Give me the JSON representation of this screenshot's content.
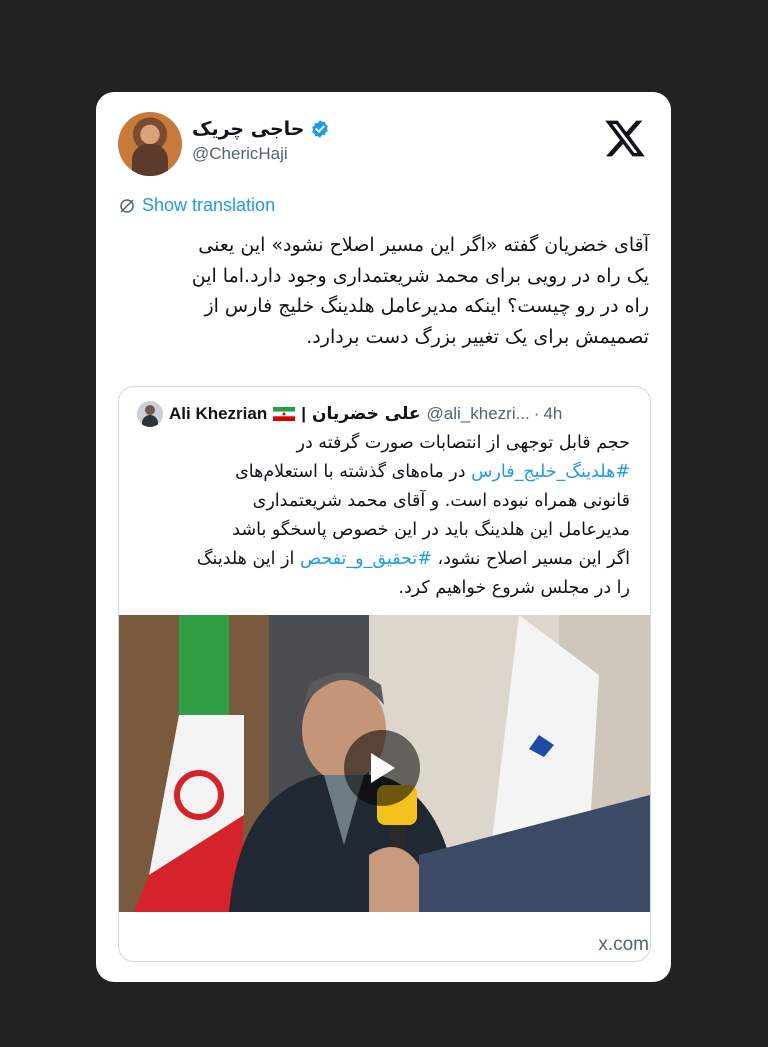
{
  "tweet": {
    "display_name": "حاجی چریک",
    "handle": "@ChericHaji",
    "translate_label": "Show translation",
    "text_lines": [
      "آقای خضریان گفته «اگر این مسیر اصلاح نشود» این یعنی",
      "یک راه در رویی برای محمد شریعتمداری وجود دارد.اما این",
      "راه در رو چیست؟ اینکه مدیرعامل هلدینگ خلیج فارس از",
      "تصمیمش برای یک تغییر بزرگ دست بردارد."
    ],
    "icons": {
      "verified": "verified-badge-icon",
      "logo": "x-logo-icon",
      "translate": "translate-icon"
    },
    "colors": {
      "link": "#1d9bf0",
      "muted": "#536471",
      "text": "#0f1419",
      "verified": "#1d9bf0"
    }
  },
  "quote": {
    "name_en": "Ali Khezrian",
    "separator": "|",
    "name_fa": "علی خضریان",
    "handle": "@ali_khezri...",
    "dot": "·",
    "time": "4h",
    "lines": [
      {
        "text": "حجم قابل توجهی از انتصابات صورت گرفته در"
      },
      {
        "link": "#هلدینگ_خلیج_فارس",
        "text": " در ماه‌های گذشته با استعلام‌های"
      },
      {
        "text": "قانونی همراه نبوده است. و آقای محمد شریعتمداری"
      },
      {
        "text": "مدیرعامل این هلدینگ باید در این خصوص پاسخگو باشد"
      },
      {
        "pre": "اگر این مسیر اصلاح نشود، ",
        "link": "#تحقیق_و_تفحص",
        "text": " از این هلدینگ"
      },
      {
        "text": "را در مجلس شروع خواهیم کرد."
      }
    ],
    "media": {
      "type": "video",
      "icon": "play-icon"
    }
  },
  "footer": {
    "source": "x.com"
  }
}
